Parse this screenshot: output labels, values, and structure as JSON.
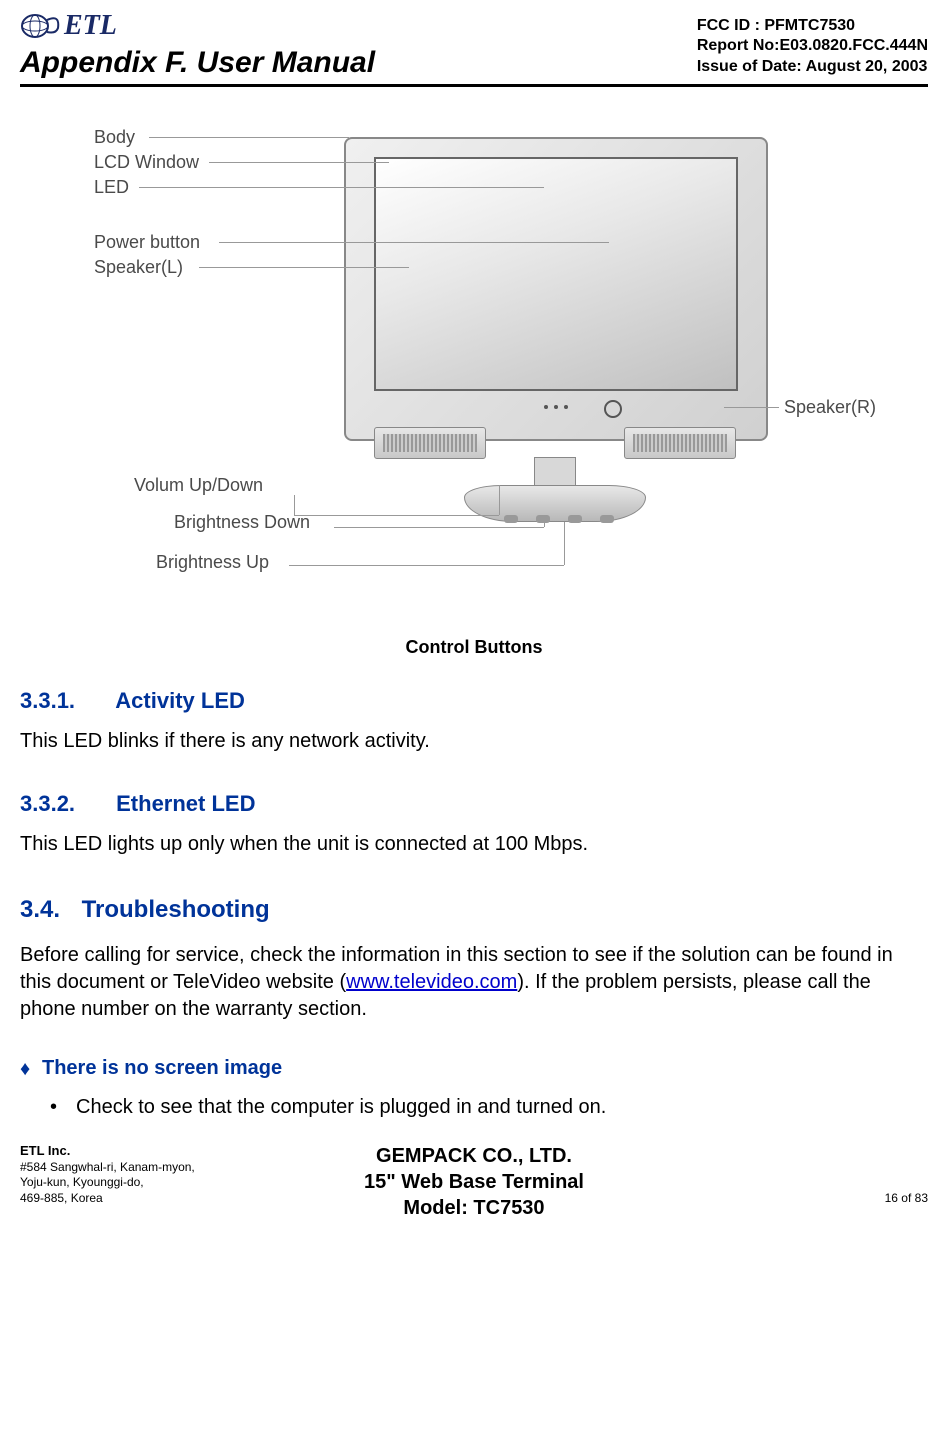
{
  "header": {
    "logo_text": "ETL",
    "appendix": "Appendix F. User Manual",
    "fcc": "FCC ID : PFMTC7530",
    "report": "Report No:E03.0820.FCC.444N",
    "issue": "Issue of Date: August 20, 2003"
  },
  "figure": {
    "labels": {
      "body": "Body",
      "lcd": "LCD Window",
      "led": "LED",
      "power": "Power button",
      "speaker_l": "Speaker(L)",
      "speaker_r": "Speaker(R)",
      "volume": "Volum Up/Down",
      "bright_down": "Brightness Down",
      "bright_up": "Brightness Up"
    },
    "caption": "Control Buttons"
  },
  "sections": {
    "s331_num": "3.3.1.",
    "s331_title": "Activity LED",
    "s331_body": "This LED blinks if there is any network activity.",
    "s332_num": "3.3.2.",
    "s332_title": "Ethernet LED",
    "s332_body": "This LED lights up only when the unit is connected at 100 Mbps.",
    "s34_num": "3.4.",
    "s34_title": "Troubleshooting",
    "s34_body_pre": "Before calling for service, check the information in this section to see if the solution can be found in this document or TeleVideo website (",
    "s34_link": "www.televideo.com",
    "s34_body_post": ").  If the problem persists, please call the phone number on the warranty section.",
    "diamond1": "There is no screen image",
    "bullet1": "Check to see that the computer is plugged in and turned on."
  },
  "footer": {
    "company": "ETL Inc.",
    "addr1": "#584 Sangwhal-ri, Kanam-myon,",
    "addr2": "Yoju-kun, Kyounggi-do,",
    "addr3": "469-885, Korea",
    "center1": "GEMPACK CO., LTD.",
    "center2": "15\" Web Base Terminal",
    "center3": "Model: TC7530",
    "page": "16 of 83"
  }
}
